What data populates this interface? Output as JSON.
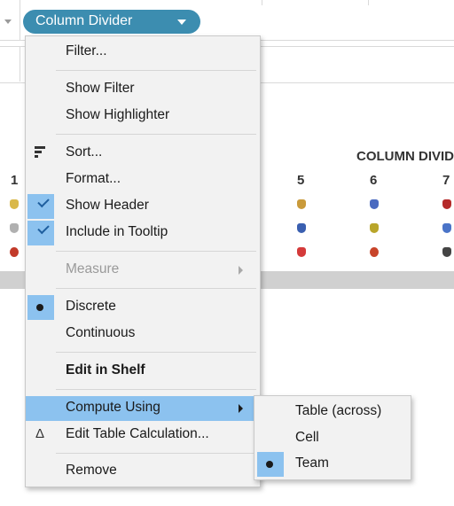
{
  "shelf": {
    "pill_label": "Column Divider"
  },
  "view": {
    "column_header": "COLUMN DIVID",
    "left_number": "1",
    "col_numbers": [
      "5",
      "6",
      "7"
    ]
  },
  "menu": {
    "items": [
      {
        "label": "Filter..."
      },
      {
        "label": "Show Filter"
      },
      {
        "label": "Show Highlighter"
      },
      {
        "label": "Sort..."
      },
      {
        "label": "Format..."
      },
      {
        "label": "Show Header"
      },
      {
        "label": "Include in Tooltip"
      },
      {
        "label": "Measure"
      },
      {
        "label": "Discrete"
      },
      {
        "label": "Continuous"
      },
      {
        "label": "Edit in Shelf"
      },
      {
        "label": "Compute Using"
      },
      {
        "label": "Edit Table Calculation..."
      },
      {
        "label": "Remove"
      }
    ]
  },
  "submenu": {
    "items": [
      {
        "label": "Table (across)"
      },
      {
        "label": "Cell"
      },
      {
        "label": "Team"
      }
    ]
  },
  "colors": {
    "pill": "#3c8db0",
    "highlight": "#8cc2ef",
    "menu_bg": "#f2f2f2"
  }
}
